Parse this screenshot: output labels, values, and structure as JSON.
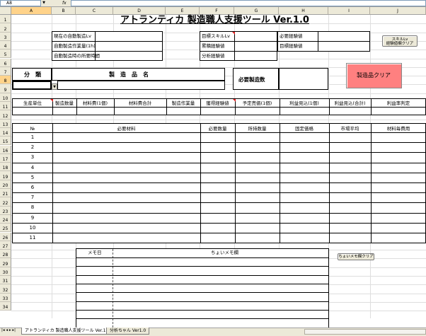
{
  "formula_bar": {
    "name_box": "A8",
    "fx": "fx",
    "value": ""
  },
  "columns": [
    "A",
    "B",
    "C",
    "D",
    "E",
    "F",
    "G",
    "H",
    "I",
    "J"
  ],
  "selected_column": "A",
  "rows": [
    "1",
    "2",
    "3",
    "4",
    "5",
    "6",
    "7",
    "8",
    "9",
    "10",
    "11",
    "12",
    "13",
    "14",
    "15",
    "16",
    "17",
    "18",
    "19",
    "20",
    "21",
    "22",
    "23",
    "24",
    "25",
    "26",
    "27",
    "28",
    "29",
    "30",
    "31",
    "32",
    "33",
    "34"
  ],
  "selected_row": "8",
  "title": "アトランティカ 製造職人支援ツール Ver.1.0",
  "info_left": [
    "現在の自動製造Lv",
    "自動製造作業量(1h)",
    "自動製造時の所要時間"
  ],
  "info_mid": [
    "目標スキルLv",
    "累積経験値",
    "分析経験値"
  ],
  "info_right": [
    "必要経験値",
    "目標経験値"
  ],
  "skill_clear_button": "スキルLv\n経験値欄クリア",
  "category_label": "分　類",
  "product_name_label": "製　造　品　名",
  "required_qty_label": "必要製造数",
  "product_clear_button": "製造品クリア",
  "dropdown_value": "",
  "header_row1": [
    "生産単位",
    "製造数量",
    "材料費(1個)",
    "材料費合計",
    "製造作業量",
    "獲得経験値",
    "予定売価(1個)",
    "利益見込(1個)",
    "利益見込(合計)",
    "利益率判定"
  ],
  "header_row2": [
    "№",
    "必要材料",
    "必要数量",
    "所持数量",
    "固定価格",
    "市場平均",
    "材料毎費用"
  ],
  "material_numbers": [
    "1",
    "2",
    "3",
    "4",
    "5",
    "6",
    "7",
    "8",
    "9",
    "10",
    "11"
  ],
  "memo_day_label": "メモ日",
  "memo_label": "ちょいメモ欄",
  "memo_clear_button": "ちょいメモ欄クリア",
  "sheet_tabs": [
    "アトランティカ 製造職人支援ツール Ver.1.0",
    "分析ちゃん Ver1.0"
  ],
  "nav_arrows": "|◂ ◂ ▸ ▸|"
}
